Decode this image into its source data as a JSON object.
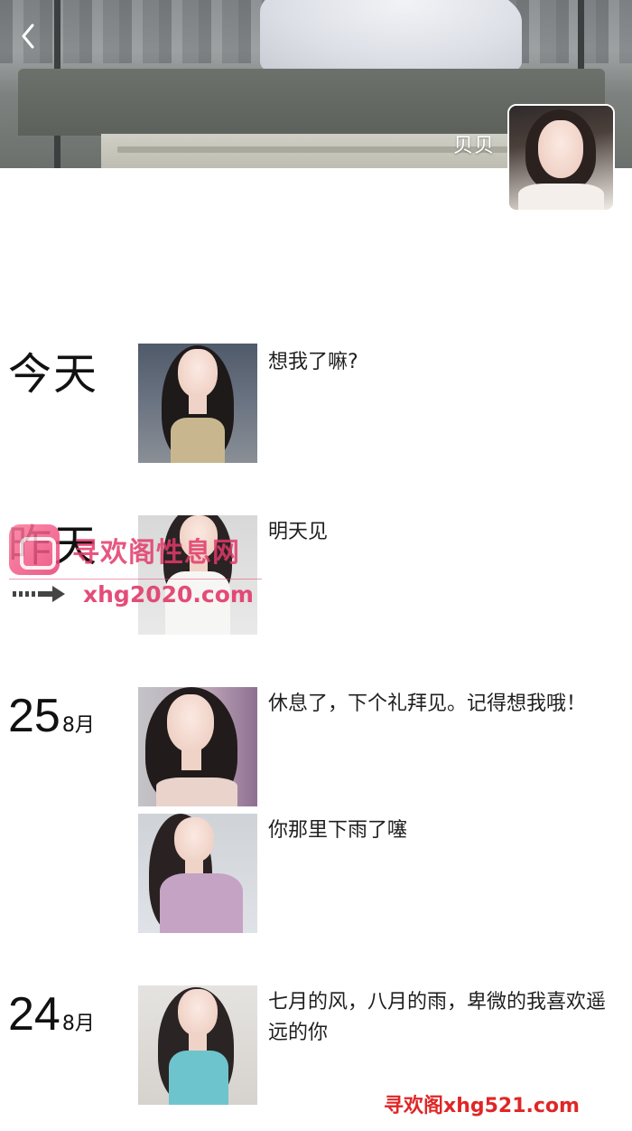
{
  "header": {
    "back_icon": "chevron-left-icon",
    "username": "贝贝"
  },
  "posts": [
    {
      "date_word": "今天",
      "caption": "想我了嘛?"
    },
    {
      "date_word": "昨天",
      "caption": "明天见"
    },
    {
      "date_day": "25",
      "date_month": "8月",
      "caption": "休息了，下个礼拜见。记得想我哦！"
    },
    {
      "caption": "你那里下雨了噻"
    },
    {
      "date_day": "24",
      "date_month": "8月",
      "caption": "七月的风，八月的雨，卑微的我喜欢遥远的你"
    }
  ],
  "watermarks": {
    "site_name": "寻欢阁性息网",
    "site_url_1": "xhg2020.com",
    "site_url_2": "寻欢阁xhg521.com"
  },
  "colors": {
    "watermark_pink": "#e23a6a",
    "watermark_red": "#e02626"
  }
}
